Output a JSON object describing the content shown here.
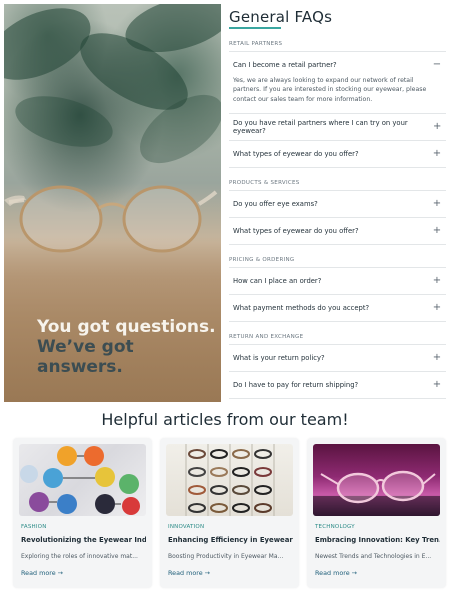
{
  "hero": {
    "headline_line1": "You got questions.",
    "headline_line2": "We’ve got answers."
  },
  "faq": {
    "title": "General FAQs",
    "accent_color": "#3aa6a0",
    "sections": [
      {
        "label": "RETAIL PARTNERS",
        "items": [
          {
            "question": "Can I become a retail partner?",
            "toggle": "−",
            "answer": "Yes, we are always looking to expand our network of retail partners. If you are interested in stocking our eyewear, please contact our sales team for more information."
          },
          {
            "question": "Do you have retail partners where I can try on your eyewear?",
            "toggle": "+"
          },
          {
            "question": "What types of eyewear do you offer?",
            "toggle": "+"
          }
        ]
      },
      {
        "label": "PRODUCTS & SERVICES",
        "items": [
          {
            "question": "Do you offer eye exams?",
            "toggle": "+"
          },
          {
            "question": "What types of eyewear do you offer?",
            "toggle": "+"
          }
        ]
      },
      {
        "label": "PRICING & ORDERING",
        "items": [
          {
            "question": "How can I place an order?",
            "toggle": "+"
          },
          {
            "question": "What payment methods do you accept?",
            "toggle": "+"
          }
        ]
      },
      {
        "label": "RETURN AND EXCHANGE",
        "items": [
          {
            "question": "What is your return policy?",
            "toggle": "+"
          },
          {
            "question": "Do I have to pay for return shipping?",
            "toggle": "+"
          }
        ]
      }
    ]
  },
  "articles": {
    "title": "Helpful articles from our team!",
    "cards": [
      {
        "category": "FASHION",
        "title": "Revolutionizing the Eyewear Indu...",
        "description": "Exploring the roles of innovative mat...",
        "read_more": "Read more →",
        "image_icon": "colorful-sunglasses-image"
      },
      {
        "category": "INNOVATION",
        "title": "Enhancing Efficiency in Eyewear ...",
        "description": "Boosting Productivity in Eyewear Ma...",
        "read_more": "Read more →",
        "image_icon": "eyewear-display-rack-image"
      },
      {
        "category": "TECHNOLOGY",
        "title": "Embracing Innovation: Key Tren...",
        "description": "Newest Trends and Technologies in E...",
        "read_more": "Read more →",
        "image_icon": "glasses-on-purple-image"
      }
    ]
  }
}
